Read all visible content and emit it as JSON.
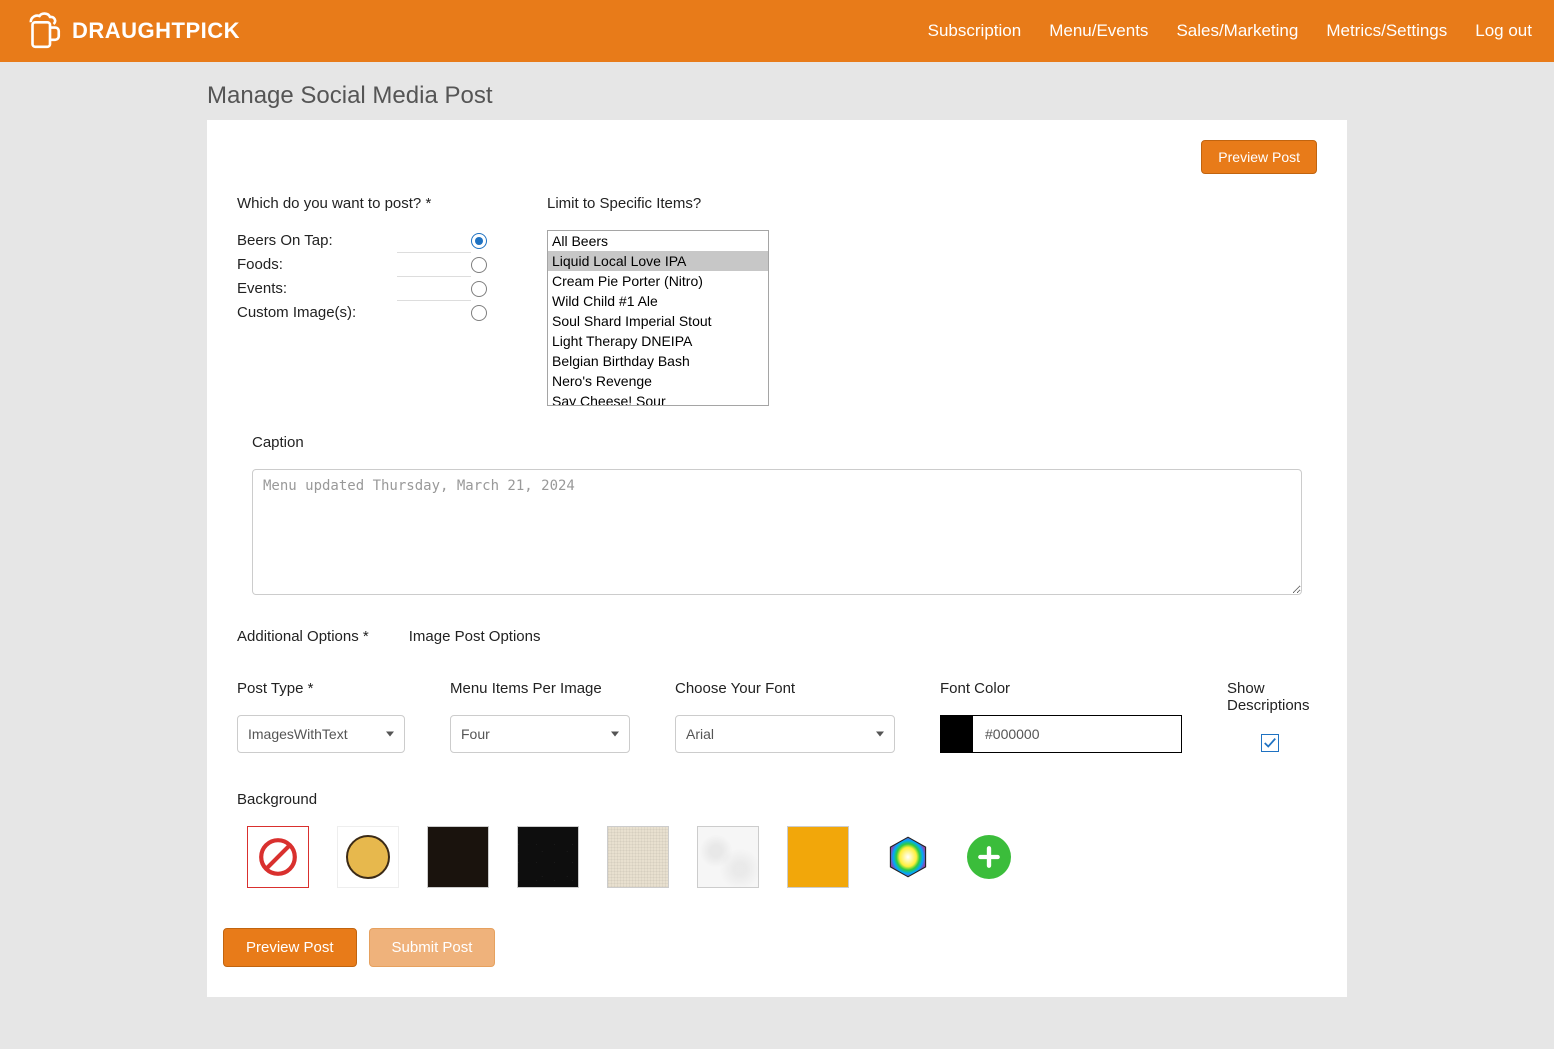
{
  "header": {
    "brand": "DRAUGHTPICK",
    "nav": {
      "subscription": "Subscription",
      "menu_events": "Menu/Events",
      "sales_marketing": "Sales/Marketing",
      "metrics_settings": "Metrics/Settings",
      "logout": "Log out"
    }
  },
  "page_title": "Manage Social Media Post",
  "buttons": {
    "preview_top": "Preview Post",
    "preview_bottom": "Preview Post",
    "submit": "Submit Post"
  },
  "post_target": {
    "label": "Which do you want to post? *",
    "options": {
      "beers": "Beers On Tap:",
      "foods": "Foods:",
      "events": "Events:",
      "custom": "Custom Image(s):"
    },
    "selected": "beers"
  },
  "limit": {
    "label": "Limit to Specific Items?",
    "options": [
      "All Beers",
      "Liquid Local Love IPA",
      "Cream Pie Porter (Nitro)",
      "Wild Child #1 Ale",
      "Soul Shard Imperial Stout",
      "Light Therapy DNEIPA",
      "Belgian Birthday Bash",
      "Nero's Revenge",
      "Say Cheese! Sour"
    ],
    "selected_index": 1
  },
  "caption": {
    "label": "Caption",
    "placeholder": "Menu updated Thursday, March 21, 2024",
    "value": ""
  },
  "option_labels": {
    "additional": "Additional Options *",
    "image_post": "Image Post Options"
  },
  "controls": {
    "post_type": {
      "label": "Post Type *",
      "value": "ImagesWithText"
    },
    "per_image": {
      "label": "Menu Items Per Image",
      "value": "Four"
    },
    "font": {
      "label": "Choose Your Font",
      "value": "Arial"
    },
    "font_color": {
      "label": "Font Color",
      "value": "#000000"
    },
    "show_descriptions": {
      "label": "Show Descriptions",
      "checked": true
    }
  },
  "background": {
    "label": "Background",
    "thumbs": [
      "none",
      "brand-circle",
      "dark-wood",
      "black-marble",
      "linen",
      "white-marble",
      "amber",
      "rainbow"
    ],
    "selected": "none"
  }
}
